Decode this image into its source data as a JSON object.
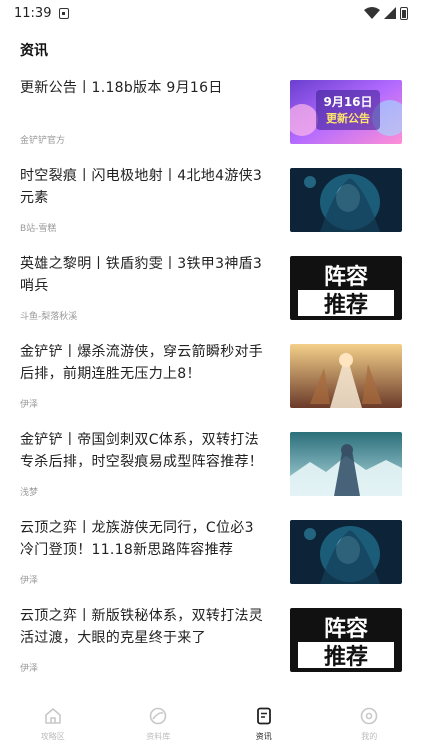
{
  "status_bar": {
    "time": "11:39"
  },
  "section_title": "资讯",
  "news": [
    {
      "title": "更新公告丨1.18b版本 9月16日",
      "source": "金铲铲官方",
      "thumb": "update-notice-banner",
      "thumb_text_1": "9月16日",
      "thumb_text_2": "更新公告"
    },
    {
      "title": "时空裂痕丨闪电极地射丨4北地4游侠3元素",
      "source": "B站-雪糕",
      "thumb": "champion-art-blue"
    },
    {
      "title": "英雄之黎明丨铁盾豹雯丨3铁甲3神盾3哨兵",
      "source": "斗鱼-梨落秋溪",
      "thumb": "lineup-recommend-banner",
      "thumb_text_1": "阵容",
      "thumb_text_2": "推荐"
    },
    {
      "title": "金铲铲丨爆杀流游侠，穿云箭瞬秒对手后排，前期连胜无压力上8！",
      "source": "伊泽",
      "thumb": "champion-art-gold"
    },
    {
      "title": "金铲铲丨帝国剑刺双C体系，双转打法专杀后排，时空裂痕易成型阵容推荐！",
      "source": "浅梦",
      "thumb": "champion-art-ice"
    },
    {
      "title": "云顶之弈丨龙族游侠无同行，C位必3冷门登顶！11.18新思路阵容推荐",
      "source": "伊泽",
      "thumb": "champion-art-blue"
    },
    {
      "title": "云顶之弈丨新版铁秘体系，双转打法灵活过渡，大眼的克星终于来了",
      "source": "伊泽",
      "thumb": "lineup-recommend-banner",
      "thumb_text_1": "阵容",
      "thumb_text_2": "推荐"
    }
  ],
  "bottom_nav": [
    {
      "label": "攻略区",
      "icon": "home-icon",
      "active": false
    },
    {
      "label": "资料库",
      "icon": "database-icon",
      "active": false
    },
    {
      "label": "资讯",
      "icon": "news-icon",
      "active": true
    },
    {
      "label": "我的",
      "icon": "profile-icon",
      "active": false
    }
  ]
}
